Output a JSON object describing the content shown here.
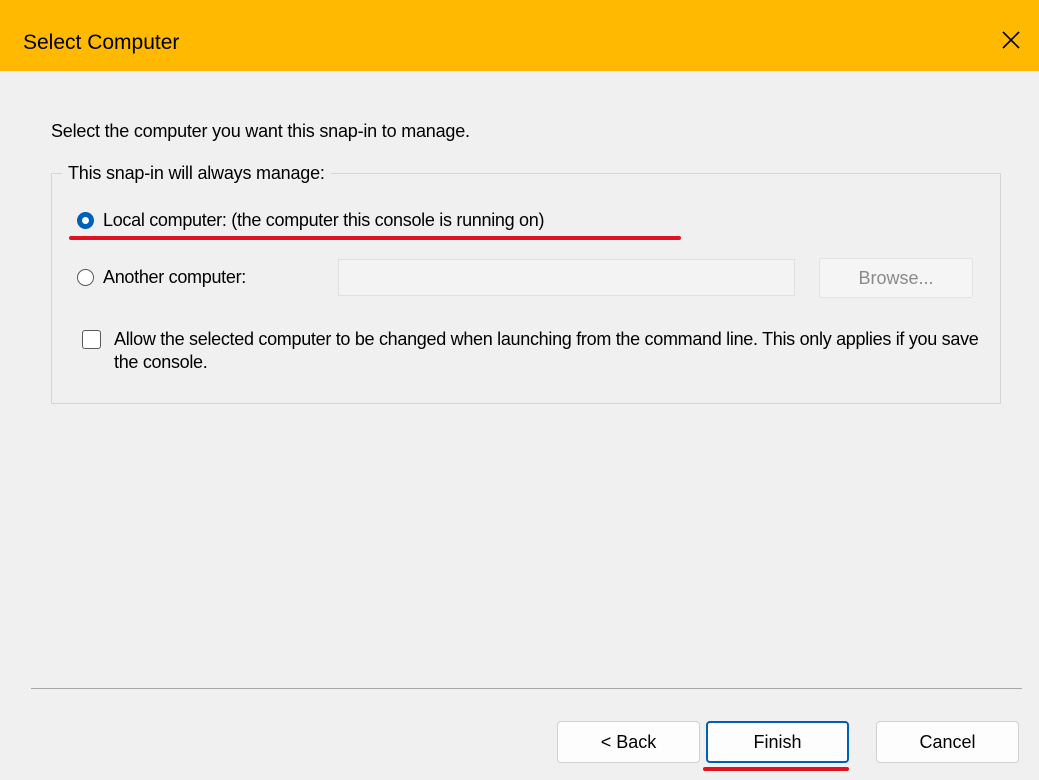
{
  "window": {
    "title": "Select Computer",
    "titlebar_color": "#ffb900",
    "close_icon": "close-icon"
  },
  "intro_text": "Select the computer you want this snap-in to manage.",
  "group": {
    "legend": "This snap-in will always manage:",
    "options": [
      {
        "label": "Local computer:  (the computer this console is running on)",
        "checked": true
      },
      {
        "label": "Another computer:",
        "checked": false
      }
    ],
    "another_computer_value": "",
    "browse_label": "Browse...",
    "allow_change": {
      "label": "Allow the selected computer to be changed when launching from the command line.  This only applies if you save the console.",
      "checked": false
    }
  },
  "buttons": {
    "back": "< Back",
    "finish": "Finish",
    "cancel": "Cancel"
  },
  "colors": {
    "accent": "#005fb8",
    "annotation_underline": "#e0141e"
  }
}
